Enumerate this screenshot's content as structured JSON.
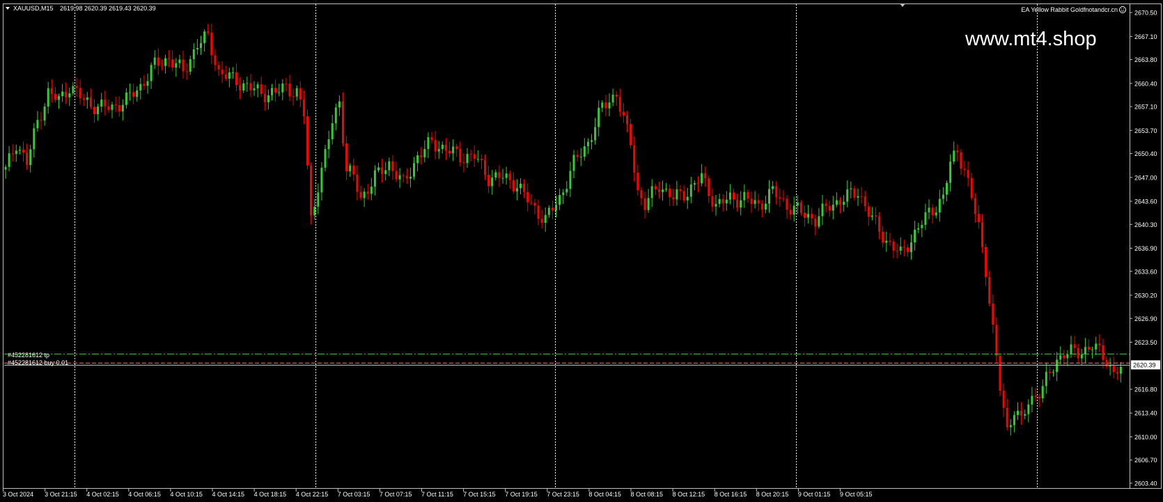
{
  "header": {
    "symbol": "XAUUSD,M15",
    "ohlc": "2619.98 2620.39 2619.43 2620.39",
    "ea_label": "EA Yellow Rabbit Goldfnotandcr.cn",
    "smiley_icon": "smiley-icon",
    "menu_icon": "triangle-down-icon"
  },
  "watermark": "www.mt4.shop",
  "orders": {
    "tp_label": "#452281612 tp",
    "buy_label": "#452281612 buy 0.01"
  },
  "current_price": "2620.39",
  "colors": {
    "background": "#000000",
    "bull": "#33cc33",
    "bear": "#ff0000",
    "grid": "#ffffff",
    "tp_line": "#33cc33",
    "order_line": "#ff6666",
    "price_line": "#c0c0c0"
  },
  "price_axis": {
    "ticks": [
      "2670.50",
      "2667.10",
      "2663.80",
      "2660.40",
      "2657.10",
      "2653.70",
      "2650.40",
      "2647.00",
      "2643.60",
      "2640.30",
      "2636.90",
      "2633.60",
      "2630.20",
      "2626.90",
      "2623.50",
      "2620.39",
      "2616.80",
      "2613.40",
      "2610.00",
      "2606.70",
      "2603.40"
    ]
  },
  "time_axis": {
    "labels": [
      "3 Oct 2024",
      "3 Oct 21:15",
      "4 Oct 02:15",
      "4 Oct 06:15",
      "4 Oct 10:15",
      "4 Oct 14:15",
      "4 Oct 18:15",
      "4 Oct 22:15",
      "7 Oct 03:15",
      "7 Oct 07:15",
      "7 Oct 11:15",
      "7 Oct 15:15",
      "7 Oct 19:15",
      "7 Oct 23:15",
      "8 Oct 04:15",
      "8 Oct 08:15",
      "8 Oct 12:15",
      "8 Oct 16:15",
      "8 Oct 20:15",
      "9 Oct 01:15",
      "9 Oct 05:15"
    ]
  },
  "chart_data": {
    "type": "candlestick",
    "symbol": "XAUUSD",
    "timeframe": "M15",
    "ylim": [
      2603.0,
      2671.5
    ],
    "grid": "day separators (dotted vertical)",
    "tp_level": 2621.9,
    "order_level": 2620.6,
    "bid": 2620.39,
    "anchors": [
      [
        0,
        2648
      ],
      [
        3,
        2652
      ],
      [
        6,
        2649
      ],
      [
        9,
        2655
      ],
      [
        12,
        2659
      ],
      [
        15,
        2658
      ],
      [
        18,
        2660
      ],
      [
        22,
        2658
      ],
      [
        26,
        2657
      ],
      [
        30,
        2657
      ],
      [
        34,
        2658
      ],
      [
        38,
        2660
      ],
      [
        42,
        2663
      ],
      [
        46,
        2664
      ],
      [
        50,
        2662
      ],
      [
        54,
        2666
      ],
      [
        57,
        2667
      ],
      [
        60,
        2662
      ],
      [
        64,
        2661
      ],
      [
        68,
        2660
      ],
      [
        72,
        2659
      ],
      [
        76,
        2659
      ],
      [
        79,
        2660
      ],
      [
        82,
        2659
      ],
      [
        84,
        2656
      ],
      [
        86,
        2641
      ],
      [
        88,
        2646
      ],
      [
        90,
        2650
      ],
      [
        92,
        2655
      ],
      [
        94,
        2658
      ],
      [
        96,
        2648
      ],
      [
        98,
        2647
      ],
      [
        100,
        2644
      ],
      [
        104,
        2647
      ],
      [
        108,
        2649
      ],
      [
        112,
        2646
      ],
      [
        116,
        2650
      ],
      [
        120,
        2652
      ],
      [
        124,
        2651
      ],
      [
        128,
        2650
      ],
      [
        132,
        2650
      ],
      [
        136,
        2647
      ],
      [
        140,
        2647
      ],
      [
        144,
        2646
      ],
      [
        148,
        2643
      ],
      [
        152,
        2641
      ],
      [
        156,
        2644
      ],
      [
        160,
        2649
      ],
      [
        164,
        2652
      ],
      [
        168,
        2657
      ],
      [
        172,
        2659
      ],
      [
        174,
        2655
      ],
      [
        176,
        2652
      ],
      [
        178,
        2645
      ],
      [
        180,
        2643
      ],
      [
        184,
        2646
      ],
      [
        188,
        2644
      ],
      [
        192,
        2645
      ],
      [
        196,
        2647
      ],
      [
        200,
        2643
      ],
      [
        204,
        2644
      ],
      [
        208,
        2644
      ],
      [
        212,
        2643
      ],
      [
        216,
        2645
      ],
      [
        220,
        2643
      ],
      [
        224,
        2642
      ],
      [
        228,
        2641
      ],
      [
        232,
        2643
      ],
      [
        236,
        2644
      ],
      [
        240,
        2645
      ],
      [
        244,
        2641
      ],
      [
        248,
        2638
      ],
      [
        252,
        2636
      ],
      [
        256,
        2639
      ],
      [
        260,
        2642
      ],
      [
        264,
        2644
      ],
      [
        266,
        2649
      ],
      [
        268,
        2651
      ],
      [
        270,
        2648
      ],
      [
        272,
        2644
      ],
      [
        274,
        2640
      ],
      [
        276,
        2634
      ],
      [
        278,
        2625
      ],
      [
        280,
        2617
      ],
      [
        282,
        2611
      ],
      [
        284,
        2614
      ],
      [
        286,
        2612
      ],
      [
        288,
        2615
      ],
      [
        292,
        2617
      ],
      [
        296,
        2621
      ],
      [
        298,
        2622
      ],
      [
        302,
        2622
      ],
      [
        306,
        2623
      ],
      [
        310,
        2621
      ],
      [
        312,
        2619
      ],
      [
        314,
        2620
      ]
    ]
  }
}
